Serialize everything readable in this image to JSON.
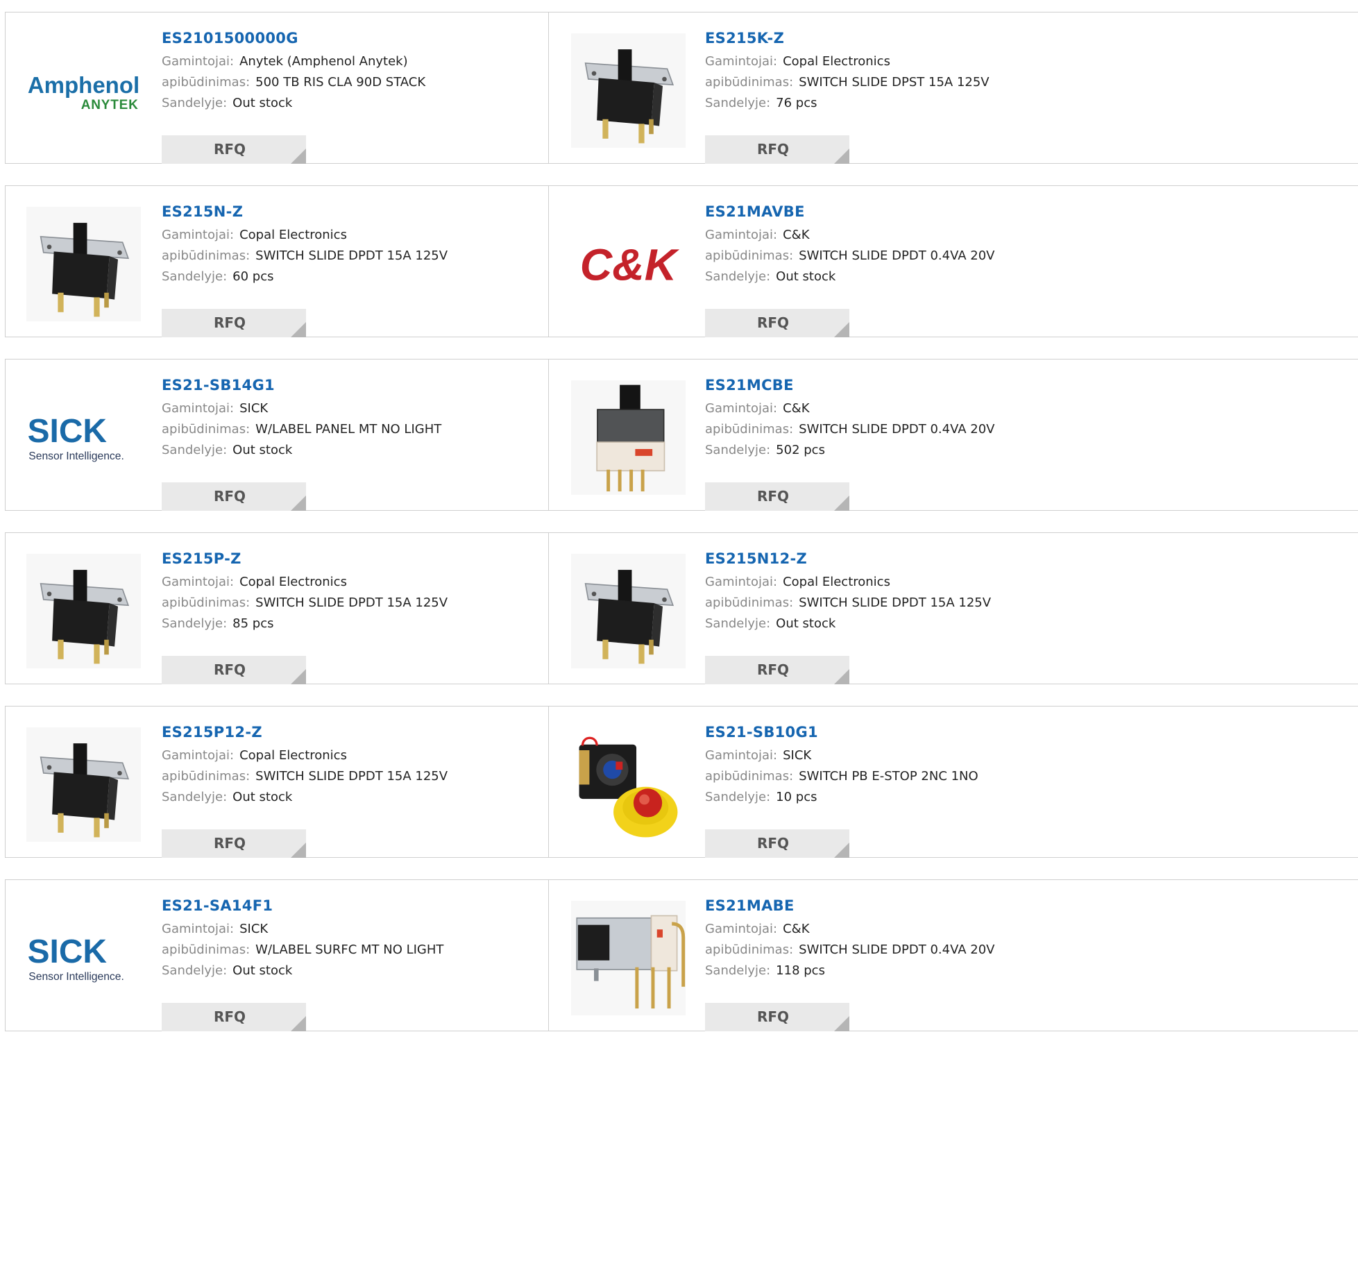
{
  "labels": {
    "manufacturer": "Gamintojai:",
    "description": "apibūdinimas:",
    "stock": "Sandelyje:",
    "rfq": "RFQ"
  },
  "products": [
    {
      "part": "ES2101500000G",
      "manufacturer": "Anytek (Amphenol Anytek)",
      "description": "500 TB RIS CLA 90D STACK",
      "stock": "Out stock",
      "image": "amphenol-anytek-logo",
      "logo_text": [
        "Amphenol",
        "ANYTEK"
      ]
    },
    {
      "part": "ES215K-Z",
      "manufacturer": "Copal Electronics",
      "description": "SWITCH SLIDE DPST 15A 125V",
      "stock": "76 pcs",
      "image": "slide-switch-photo"
    },
    {
      "part": "ES215N-Z",
      "manufacturer": "Copal Electronics",
      "description": "SWITCH SLIDE DPDT 15A 125V",
      "stock": "60 pcs",
      "image": "slide-switch-photo"
    },
    {
      "part": "ES21MAVBE",
      "manufacturer": "C&K",
      "description": "SWITCH SLIDE DPDT 0.4VA 20V",
      "stock": "Out stock",
      "image": "ck-logo",
      "logo_text": [
        "C&K"
      ]
    },
    {
      "part": "ES21-SB14G1",
      "manufacturer": "SICK",
      "description": "W/LABEL PANEL MT NO LIGHT",
      "stock": "Out stock",
      "image": "sick-logo",
      "logo_text": [
        "SICK",
        "Sensor Intelligence."
      ]
    },
    {
      "part": "ES21MCBE",
      "manufacturer": "C&K",
      "description": "SWITCH SLIDE DPDT 0.4VA 20V",
      "stock": "502 pcs",
      "image": "vertical-slide-switch-photo"
    },
    {
      "part": "ES215P-Z",
      "manufacturer": "Copal Electronics",
      "description": "SWITCH SLIDE DPDT 15A 125V",
      "stock": "85 pcs",
      "image": "slide-switch-photo"
    },
    {
      "part": "ES215N12-Z",
      "manufacturer": "Copal Electronics",
      "description": "SWITCH SLIDE DPDT 15A 125V",
      "stock": "Out stock",
      "image": "slide-switch-photo"
    },
    {
      "part": "ES215P12-Z",
      "manufacturer": "Copal Electronics",
      "description": "SWITCH SLIDE DPDT 15A 125V",
      "stock": "Out stock",
      "image": "slide-switch-photo"
    },
    {
      "part": "ES21-SB10G1",
      "manufacturer": "SICK",
      "description": "SWITCH PB E-STOP 2NC 1NO",
      "stock": "10 pcs",
      "image": "estop-switch-photo"
    },
    {
      "part": "ES21-SA14F1",
      "manufacturer": "SICK",
      "description": "W/LABEL SURFC MT NO LIGHT",
      "stock": "Out stock",
      "image": "sick-logo",
      "logo_text": [
        "SICK",
        "Sensor Intelligence."
      ]
    },
    {
      "part": "ES21MABE",
      "manufacturer": "C&K",
      "description": "SWITCH SLIDE DPDT 0.4VA 20V",
      "stock": "118 pcs",
      "image": "right-angle-switch-photo"
    }
  ]
}
